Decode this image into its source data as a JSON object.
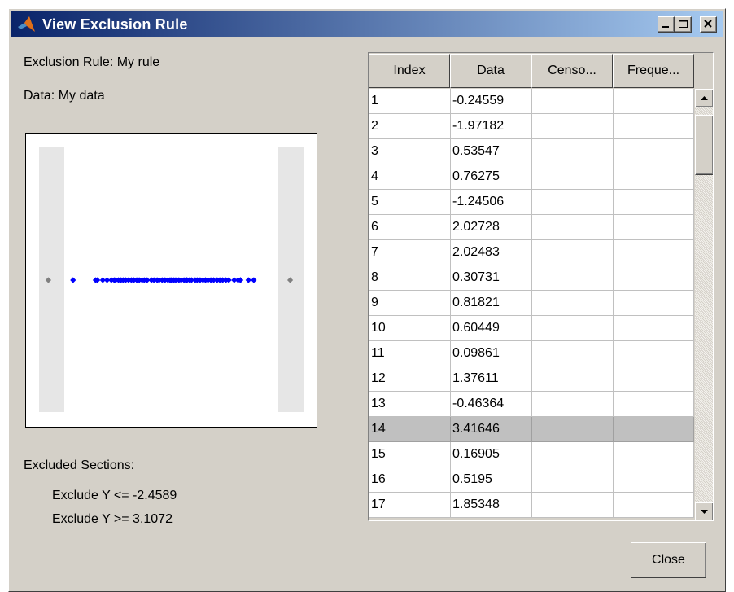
{
  "window": {
    "title": "View Exclusion Rule",
    "icon": "matlab-logo-icon",
    "controls": [
      "minimize-icon",
      "maximize-icon",
      "close-icon"
    ]
  },
  "info": {
    "rule_label": "Exclusion Rule: My rule",
    "data_label": "Data: My data"
  },
  "plot": {
    "type": "scatter",
    "points": [
      -2.65,
      -2.02,
      -1.97,
      -1.82,
      -1.7,
      -1.58,
      -1.5,
      -1.46,
      -1.38,
      -1.31,
      -1.25,
      -1.18,
      -1.1,
      -1.02,
      -0.95,
      -0.87,
      -0.8,
      -0.72,
      -0.66,
      -0.58,
      -0.46,
      -0.39,
      -0.3,
      -0.245,
      -0.16,
      -0.08,
      0.0,
      0.06,
      0.099,
      0.169,
      0.22,
      0.307,
      0.37,
      0.45,
      0.5,
      0.5195,
      0.535,
      0.604,
      0.66,
      0.763,
      0.818,
      0.9,
      0.98,
      1.05,
      1.12,
      1.2,
      1.28,
      1.376,
      1.45,
      1.53,
      1.62,
      1.7,
      1.853,
      1.96,
      2.025,
      2.027,
      2.25,
      2.4
    ],
    "excluded_points": [
      -3.34,
      3.416
    ],
    "exclude_low": -2.4589,
    "exclude_high": 3.1072,
    "x_range": [
      -3.6,
      3.79
    ],
    "point_color": "#0000ff",
    "excluded_color": "#808080",
    "region_color": "#e6e6e6"
  },
  "excluded": {
    "heading": "Excluded Sections:",
    "lines": [
      "Exclude Y <= -2.4589",
      "Exclude Y >= 3.1072"
    ]
  },
  "table": {
    "columns": [
      "Index",
      "Data",
      "Censo...",
      "Freque..."
    ],
    "rows": [
      [
        "1",
        "-0.24559",
        "",
        ""
      ],
      [
        "2",
        "-1.97182",
        "",
        ""
      ],
      [
        "3",
        "0.53547",
        "",
        ""
      ],
      [
        "4",
        "0.76275",
        "",
        ""
      ],
      [
        "5",
        "-1.24506",
        "",
        ""
      ],
      [
        "6",
        "2.02728",
        "",
        ""
      ],
      [
        "7",
        "2.02483",
        "",
        ""
      ],
      [
        "8",
        "0.30731",
        "",
        ""
      ],
      [
        "9",
        "0.81821",
        "",
        ""
      ],
      [
        "10",
        "0.60449",
        "",
        ""
      ],
      [
        "11",
        "0.09861",
        "",
        ""
      ],
      [
        "12",
        "1.37611",
        "",
        ""
      ],
      [
        "13",
        "-0.46364",
        "",
        ""
      ],
      [
        "14",
        "3.41646",
        "",
        ""
      ],
      [
        "15",
        "0.16905",
        "",
        ""
      ],
      [
        "16",
        "0.5195",
        "",
        ""
      ],
      [
        "17",
        "1.85348",
        "",
        ""
      ]
    ],
    "selected_row": 13,
    "scroll_icons": [
      "scroll-up-arrow-icon",
      "scroll-down-arrow-icon"
    ]
  },
  "buttons": {
    "close": "Close"
  }
}
